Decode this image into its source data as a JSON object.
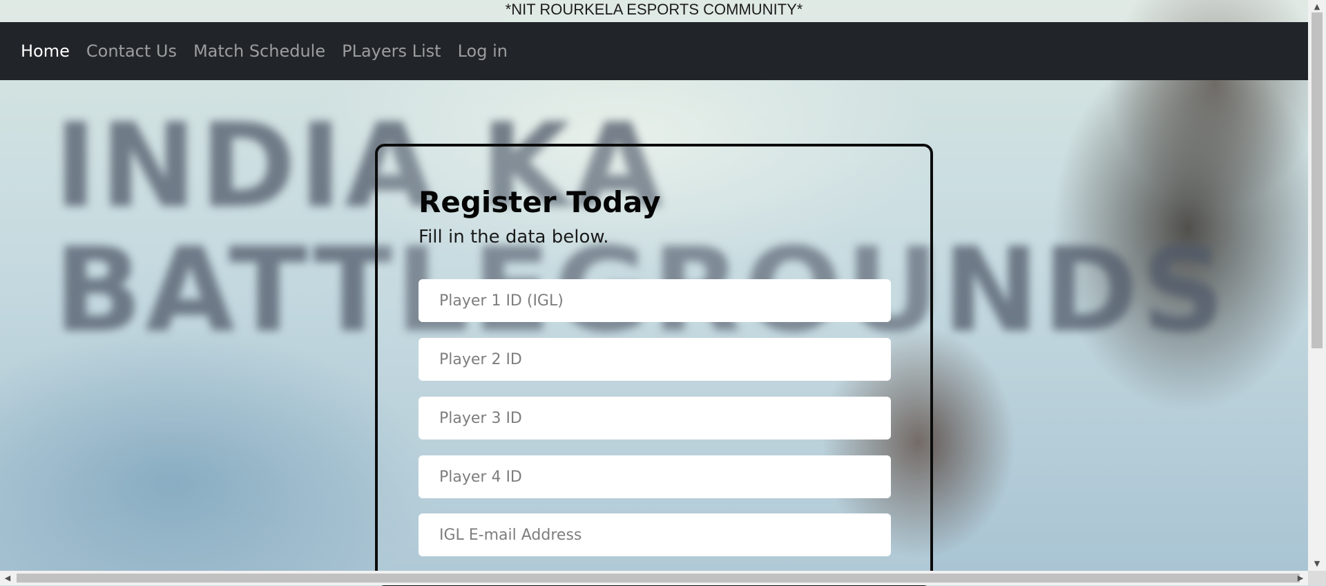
{
  "banner": {
    "text": "*NIT ROURKELA ESPORTS COMMUNITY*"
  },
  "background": {
    "art_text": "INDIA KA\nBATTLEGROUNDS"
  },
  "nav": {
    "items": [
      {
        "label": "Home",
        "active": true
      },
      {
        "label": "Contact Us",
        "active": false
      },
      {
        "label": "Match Schedule",
        "active": false
      },
      {
        "label": "PLayers List",
        "active": false
      },
      {
        "label": "Log in",
        "active": false
      }
    ]
  },
  "form": {
    "title": "Register Today",
    "subtitle": "Fill in the data below.",
    "fields": [
      {
        "placeholder": "Player 1 ID (IGL)",
        "value": ""
      },
      {
        "placeholder": "Player 2 ID",
        "value": ""
      },
      {
        "placeholder": "Player 3 ID",
        "value": ""
      },
      {
        "placeholder": "Player 4 ID",
        "value": ""
      },
      {
        "placeholder": "IGL E-mail Address",
        "value": ""
      }
    ]
  },
  "scrollbars": {
    "up_icon": "triangle-up-icon",
    "down_icon": "triangle-down-icon",
    "left_icon": "triangle-left-icon",
    "right_icon": "triangle-right-icon"
  },
  "colors": {
    "navbar": "#212529",
    "nav_active": "#ffffff",
    "nav_inactive": "#a6a8aa",
    "card_border": "#0b0b0b"
  }
}
